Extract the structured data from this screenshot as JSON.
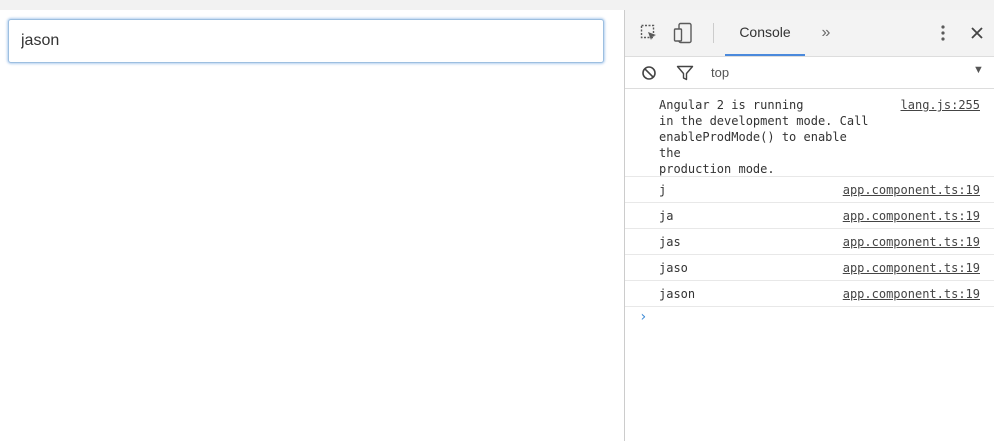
{
  "page": {
    "input_value": "jason"
  },
  "devtools": {
    "toolbar": {
      "console_tab": "Console",
      "more_tabs": "»"
    },
    "filterbar": {
      "context": "top"
    },
    "messages": [
      {
        "text": "Angular 2 is running\nin the development mode. Call\nenableProdMode() to enable the\nproduction mode.",
        "source": "lang.js:255"
      },
      {
        "text": "j",
        "source": "app.component.ts:19"
      },
      {
        "text": "ja",
        "source": "app.component.ts:19"
      },
      {
        "text": "jas",
        "source": "app.component.ts:19"
      },
      {
        "text": "jaso",
        "source": "app.component.ts:19"
      },
      {
        "text": "jason",
        "source": "app.component.ts:19"
      }
    ]
  }
}
